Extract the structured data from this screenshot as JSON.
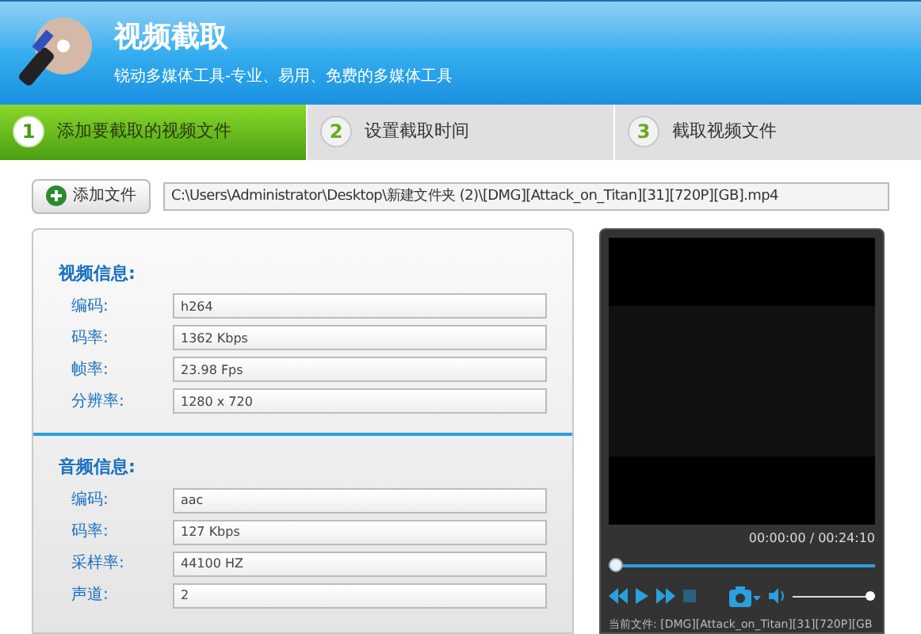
{
  "header": {
    "title": "视频截取",
    "subtitle": "锐动多媒体工具-专业、易用、免费的多媒体工具"
  },
  "steps": [
    {
      "number": "1",
      "label": "添加要截取的视频文件",
      "selected": true
    },
    {
      "number": "2",
      "label": "设置截取时间",
      "selected": false
    },
    {
      "number": "3",
      "label": "截取视频文件",
      "selected": false
    }
  ],
  "add_file": {
    "button": "添加文件",
    "path": "C:\\Users\\Administrator\\Desktop\\新建文件夹 (2)\\[DMG][Attack_on_Titan][31][720P][GB].mp4"
  },
  "sections": [
    {
      "title": "视频信息:",
      "fields": [
        {
          "label": "编码:",
          "value": "h264"
        },
        {
          "label": "码率:",
          "value": "1362 Kbps"
        },
        {
          "label": "帧率:",
          "value": "23.98 Fps"
        },
        {
          "label": "分辨率:",
          "value": "1280 x 720"
        }
      ]
    },
    {
      "title": "音频信息:",
      "fields": [
        {
          "label": "编码:",
          "value": "aac"
        },
        {
          "label": "码率:",
          "value": "127 Kbps"
        },
        {
          "label": "采样率:",
          "value": "44100 HZ"
        },
        {
          "label": "声道:",
          "value": "2"
        }
      ]
    }
  ],
  "player": {
    "time": "00:00:00 / 00:24:10",
    "seek": {
      "level": 0
    },
    "volume": {
      "level": 1
    },
    "current_file": "当前文件: [DMG][Attack_on_Titan][31][720P][GB"
  }
}
